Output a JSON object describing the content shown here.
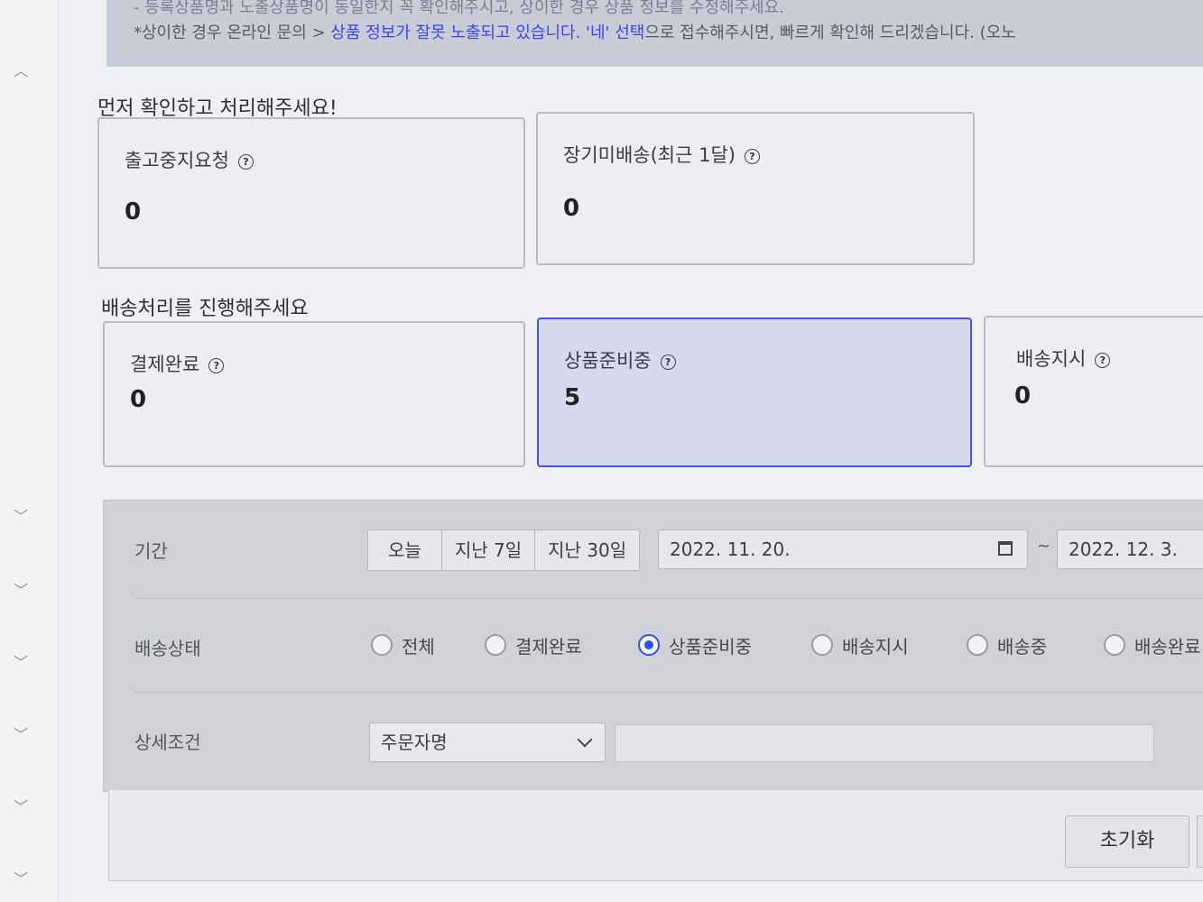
{
  "notice": {
    "line1": "- 등록상품명과 노출상품명이 동일한지 꼭 확인해주시고, 상이한 경우 상품 정보를 수정해주세요.",
    "line2_prefix": "*상이한 경우 온라인 문의 > ",
    "line2_link": "상품 정보가 잘못 노출되고 있습니다. '네' 선택",
    "line2_suffix": "으로 접수해주시면, 빠르게 확인해 드리겠습니다. (오노"
  },
  "sections": {
    "urgent_title": "먼저 확인하고 처리해주세요!",
    "shipping_title": "배송처리를 진행해주세요"
  },
  "urgent_cards": [
    {
      "label": "출고중지요청",
      "count": "0"
    },
    {
      "label": "장기미배송(최근 1달)",
      "count": "0"
    }
  ],
  "shipping_cards": [
    {
      "label": "결제완료",
      "count": "0"
    },
    {
      "label": "상품준비중",
      "count": "5"
    },
    {
      "label": "배송지시",
      "count": "0"
    }
  ],
  "help_glyph": "?",
  "filter": {
    "period_label": "기간",
    "period_buttons": [
      "오늘",
      "지난 7일",
      "지난 30일"
    ],
    "date_from": "2022. 11. 20.",
    "date_separator": "~",
    "date_to": "2022. 12. 3.",
    "status_label": "배송상태",
    "status_options": [
      "전체",
      "결제완료",
      "상품준비중",
      "배송지시",
      "배송중",
      "배송완료"
    ],
    "status_selected": "상품준비중",
    "detail_label": "상세조건",
    "detail_select": "주문자명",
    "detail_input_value": ""
  },
  "actions": {
    "reset_label": "초기화"
  },
  "colors": {
    "accent": "#2f4ff0",
    "active_card_border": "#4057e6",
    "link": "#3a46e6"
  }
}
